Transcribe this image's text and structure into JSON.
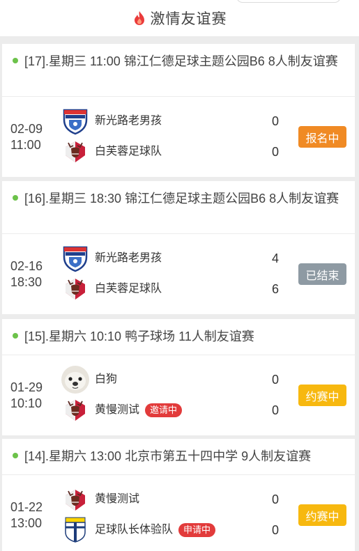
{
  "header": {
    "title": "激情友谊赛",
    "icon": "fire-icon"
  },
  "colors": {
    "signup": "#f08a24",
    "ended": "#8e9aa3",
    "matching": "#f7b80f",
    "badge": "#e23b3b",
    "dot": "#6cc24a"
  },
  "matches": [
    {
      "title": "[17].星期三 11:00 锦江仁德足球主题公园B6 8人制友谊赛",
      "date": "02-09",
      "time": "11:00",
      "home": {
        "name": "新光路老男孩",
        "score": "0",
        "logo": "shield-logo"
      },
      "away": {
        "name": "白芙蓉足球队",
        "score": "0",
        "logo": "deer-logo"
      },
      "status": "报名中"
    },
    {
      "title": "[16].星期三 18:30 锦江仁德足球主题公园B6 8人制友谊赛",
      "date": "02-16",
      "time": "18:30",
      "home": {
        "name": "新光路老男孩",
        "score": "4",
        "logo": "shield-logo"
      },
      "away": {
        "name": "白芙蓉足球队",
        "score": "6",
        "logo": "deer-logo"
      },
      "status": "已结束"
    },
    {
      "title": "[15].星期六 10:10 鸭子球场 11人制友谊赛",
      "date": "01-29",
      "time": "10:10",
      "home": {
        "name": "白狗",
        "score": "0",
        "logo": "dog-avatar"
      },
      "away": {
        "name": "黄慢测试",
        "score": "0",
        "logo": "deer-logo",
        "badge": "邀请中"
      },
      "status": "约赛中"
    },
    {
      "title": "[14].星期六 13:00 北京市第五十四中学 9人制友谊赛",
      "date": "01-22",
      "time": "13:00",
      "home": {
        "name": "黄慢测试",
        "score": "0",
        "logo": "deer-logo"
      },
      "away": {
        "name": "足球队长体验队",
        "score": "0",
        "logo": "parma-shield-logo",
        "badge": "申请中"
      },
      "status": "约赛中"
    }
  ]
}
